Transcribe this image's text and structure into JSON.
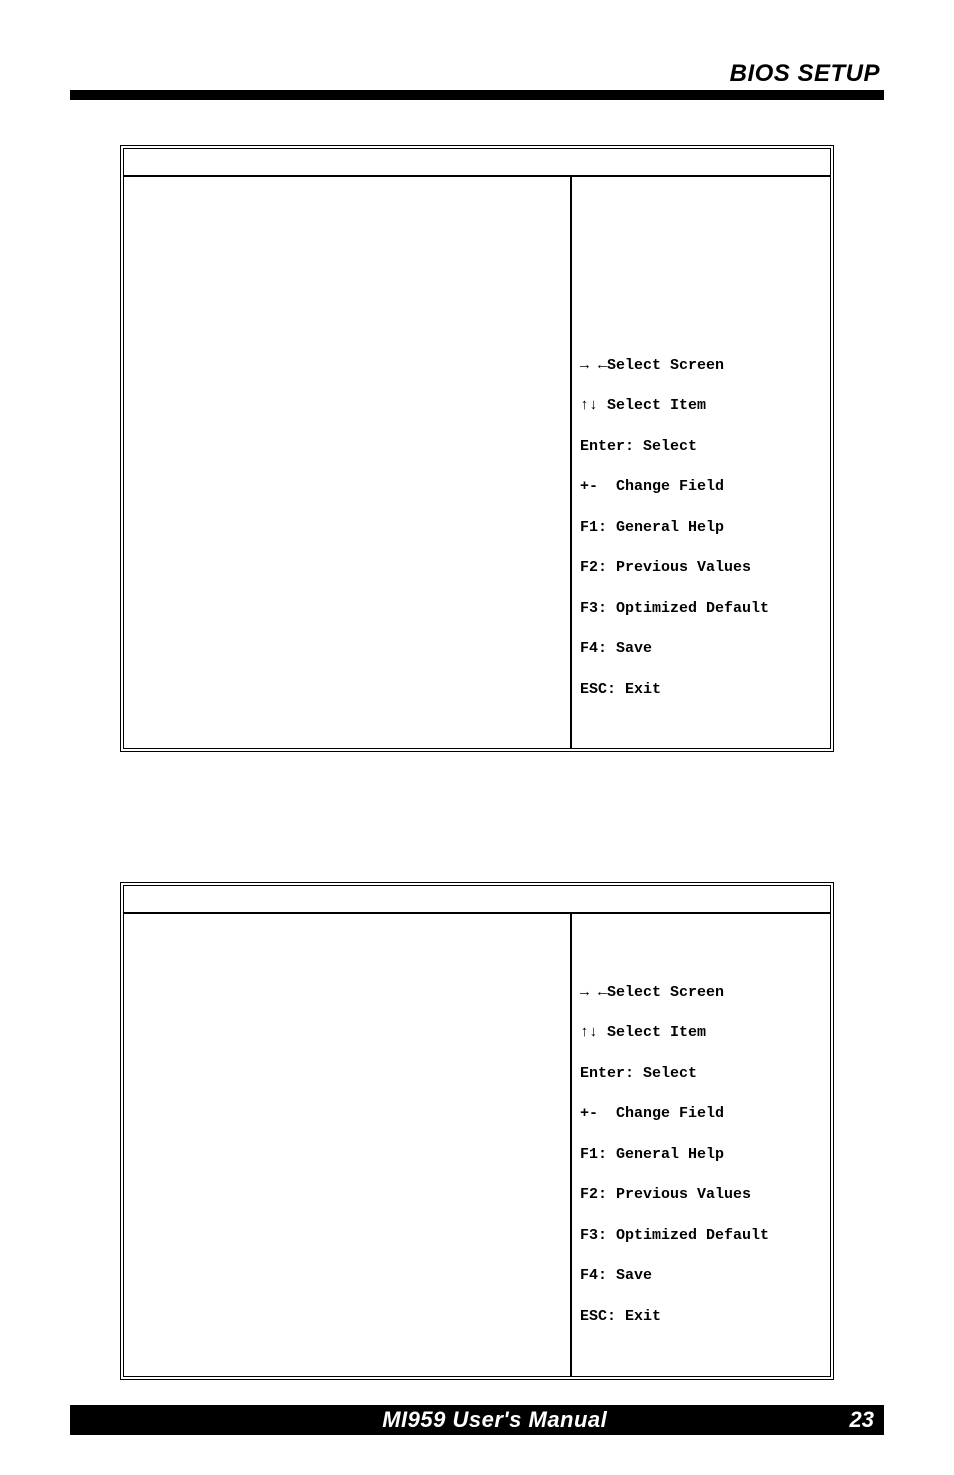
{
  "header": {
    "title": "BIOS SETUP"
  },
  "box1": {
    "help": {
      "line1": "→ ←Select Screen",
      "line2": "↑↓ Select Item",
      "line3": "Enter: Select",
      "line4": "+-  Change Field",
      "line5": "F1: General Help",
      "line6": "F2: Previous Values",
      "line7": "F3: Optimized Default",
      "line8": "F4: Save",
      "line9": "ESC: Exit"
    }
  },
  "box2": {
    "help": {
      "line1": "→ ←Select Screen",
      "line2": "↑↓ Select Item",
      "line3": "Enter: Select",
      "line4": "+-  Change Field",
      "line5": "F1: General Help",
      "line6": "F2: Previous Values",
      "line7": "F3: Optimized Default",
      "line8": "F4: Save",
      "line9": "ESC: Exit"
    }
  },
  "footer": {
    "manual": "MI959 User's Manual",
    "page": "23"
  }
}
